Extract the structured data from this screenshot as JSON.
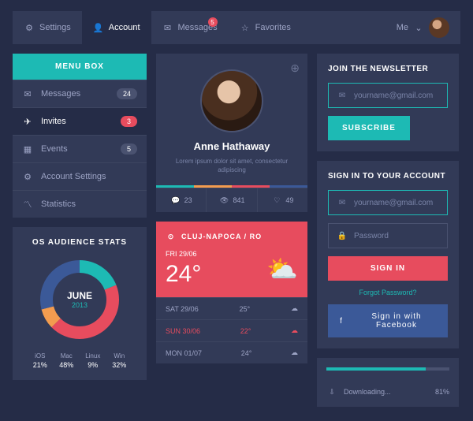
{
  "nav": {
    "items": [
      {
        "label": "Settings"
      },
      {
        "label": "Account"
      },
      {
        "label": "Messages",
        "badge": "5"
      },
      {
        "label": "Favorites"
      }
    ],
    "user": "Me"
  },
  "menu": {
    "header": "MENU BOX",
    "items": [
      {
        "label": "Messages",
        "badge": "24"
      },
      {
        "label": "Invites",
        "badge": "3"
      },
      {
        "label": "Events",
        "badge": "5"
      },
      {
        "label": "Account Settings"
      },
      {
        "label": "Statistics"
      }
    ]
  },
  "chart": {
    "title": "OS AUDIENCE STATS",
    "month": "JUNE",
    "year": "2013",
    "legend": [
      {
        "lbl": "iOS",
        "val": "21%"
      },
      {
        "lbl": "Mac",
        "val": "48%"
      },
      {
        "lbl": "Linux",
        "val": "9%"
      },
      {
        "lbl": "Win",
        "val": "32%"
      }
    ]
  },
  "chart_data": {
    "type": "pie",
    "title": "OS AUDIENCE STATS",
    "categories": [
      "iOS",
      "Mac",
      "Linux",
      "Win"
    ],
    "values": [
      21,
      48,
      9,
      32
    ],
    "colors": [
      "#1dbab4",
      "#e74c5e",
      "#f39c4f",
      "#3b5998"
    ],
    "period": {
      "month": "JUNE",
      "year": "2013"
    }
  },
  "profile": {
    "name": "Anne Hathaway",
    "desc": "Lorem ipsum dolor sit amet, consectetur adipiscing",
    "stats": {
      "comments": "23",
      "views": "841",
      "likes": "49"
    }
  },
  "weather": {
    "location": "CLUJ-NAPOCA / RO",
    "today": {
      "date": "FRI 29/06",
      "temp": "24°"
    },
    "forecast": [
      {
        "date": "SAT 29/06",
        "temp": "25°"
      },
      {
        "date": "SUN 30/06",
        "temp": "22°"
      },
      {
        "date": "MON 01/07",
        "temp": "24°"
      }
    ]
  },
  "newsletter": {
    "title": "JOIN THE NEWSLETTER",
    "placeholder": "yourname@gmail.com",
    "button": "SUBSCRIBE"
  },
  "signin": {
    "title": "SIGN IN TO YOUR ACCOUNT",
    "email": "yourname@gmail.com",
    "password": "Password",
    "button": "SIGN IN",
    "forgot": "Forgot Password?",
    "fb": "Sign in with Facebook"
  },
  "download": {
    "label": "Downloading...",
    "percent": "81%"
  }
}
